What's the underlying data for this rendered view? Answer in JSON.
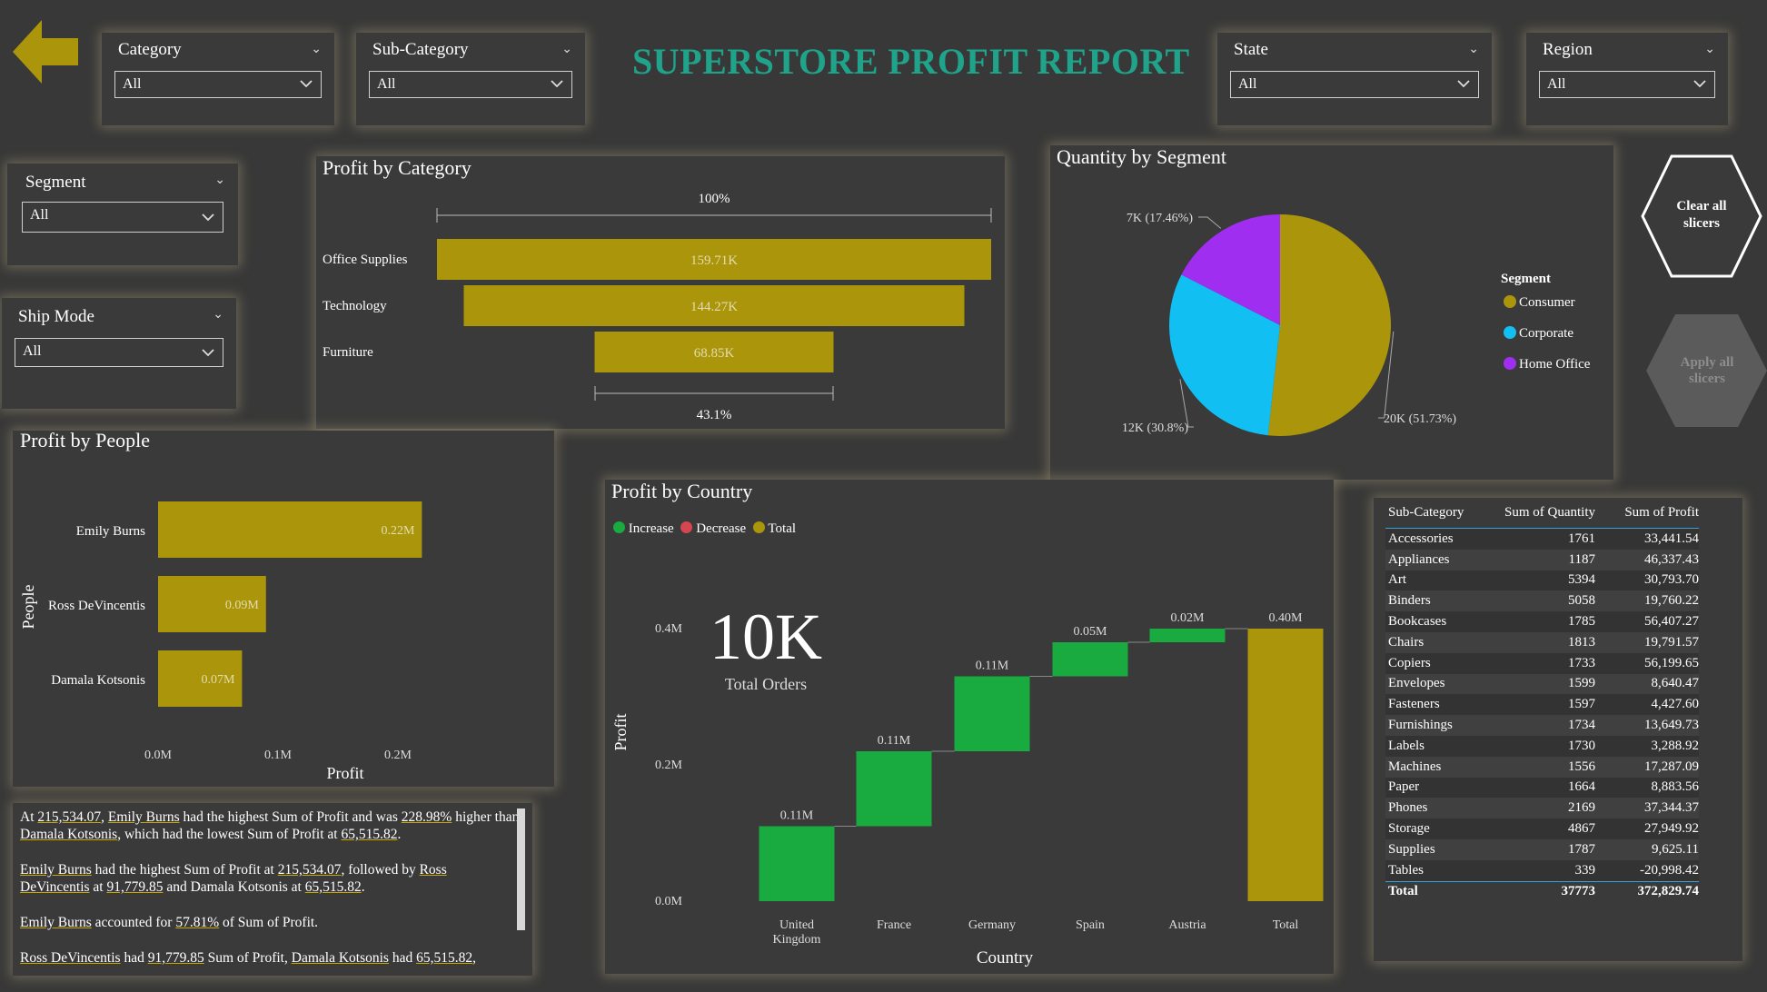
{
  "title": "SUPERSTORE PROFIT REPORT",
  "slicers": {
    "category": {
      "label": "Category",
      "value": "All"
    },
    "subcategory": {
      "label": "Sub-Category",
      "value": "All"
    },
    "state": {
      "label": "State",
      "value": "All"
    },
    "region": {
      "label": "Region",
      "value": "All"
    },
    "segment": {
      "label": "Segment",
      "value": "All"
    },
    "shipmode": {
      "label": "Ship Mode",
      "value": "All"
    }
  },
  "buttons": {
    "clear": "Clear all slicers",
    "apply": "Apply all slicers"
  },
  "colors": {
    "gold": "#ab950a",
    "green": "#1aab40",
    "blue": "#12bff2",
    "purple": "#a02ef0",
    "red": "#d64550",
    "title": "#1fa38a"
  },
  "profit_by_category": {
    "title": "Profit by Category",
    "top_pct": "100%",
    "bottom_pct": "43.1%",
    "chart_data": {
      "type": "bar",
      "categories": [
        "Office Supplies",
        "Technology",
        "Furniture"
      ],
      "values": [
        159.71,
        144.27,
        68.85
      ],
      "labels": [
        "159.71K",
        "144.27K",
        "68.85K"
      ]
    }
  },
  "quantity_by_segment": {
    "title": "Quantity by Segment",
    "legend_title": "Segment",
    "chart_data": {
      "type": "pie",
      "categories": [
        "Consumer",
        "Corporate",
        "Home Office"
      ],
      "values": [
        51.73,
        30.8,
        17.46
      ],
      "labels": [
        "20K (51.73%)",
        "12K (30.8%)",
        "7K (17.46%)"
      ]
    }
  },
  "profit_by_people": {
    "title": "Profit by People",
    "xlabel": "Profit",
    "ylabel": "People",
    "ticks": [
      "0.0M",
      "0.1M",
      "0.2M"
    ],
    "chart_data": {
      "type": "bar",
      "categories": [
        "Emily Burns",
        "Ross DeVincentis",
        "Damala Kotsonis"
      ],
      "values": [
        0.22,
        0.09,
        0.07
      ],
      "labels": [
        "0.22M",
        "0.09M",
        "0.07M"
      ],
      "xlim": [
        0,
        0.25
      ]
    }
  },
  "profit_by_country": {
    "title": "Profit by Country",
    "legend": [
      "Increase",
      "Decrease",
      "Total"
    ],
    "xlabel": "Country",
    "ylabel": "Profit",
    "yticks": [
      "0.4M",
      "0.2M",
      "0.0M"
    ],
    "kpi_value": "10K",
    "kpi_label": "Total Orders",
    "chart_data": {
      "type": "bar",
      "categories": [
        "United Kingdom",
        "France",
        "Germany",
        "Spain",
        "Austria",
        "Total"
      ],
      "values": [
        0.11,
        0.11,
        0.11,
        0.05,
        0.02,
        0.4
      ],
      "labels": [
        "0.11M",
        "0.11M",
        "0.11M",
        "0.05M",
        "0.02M",
        "0.40M"
      ],
      "ylim": [
        0,
        0.4
      ]
    }
  },
  "table": {
    "headers": [
      "Sub-Category",
      "Sum of Quantity",
      "Sum of Profit"
    ],
    "rows": [
      [
        "Accessories",
        "1761",
        "33,441.54"
      ],
      [
        "Appliances",
        "1187",
        "46,337.43"
      ],
      [
        "Art",
        "5394",
        "30,793.70"
      ],
      [
        "Binders",
        "5058",
        "19,760.22"
      ],
      [
        "Bookcases",
        "1785",
        "56,407.27"
      ],
      [
        "Chairs",
        "1813",
        "19,791.57"
      ],
      [
        "Copiers",
        "1733",
        "56,199.65"
      ],
      [
        "Envelopes",
        "1599",
        "8,640.47"
      ],
      [
        "Fasteners",
        "1597",
        "4,427.60"
      ],
      [
        "Furnishings",
        "1734",
        "13,649.73"
      ],
      [
        "Labels",
        "1730",
        "3,288.92"
      ],
      [
        "Machines",
        "1556",
        "17,287.09"
      ],
      [
        "Paper",
        "1664",
        "8,883.56"
      ],
      [
        "Phones",
        "2169",
        "37,344.37"
      ],
      [
        "Storage",
        "4867",
        "27,949.92"
      ],
      [
        "Supplies",
        "1787",
        "9,625.11"
      ],
      [
        "Tables",
        "339",
        "-20,998.42"
      ]
    ],
    "total": [
      "Total",
      "37773",
      "372,829.74"
    ]
  },
  "narrative": {
    "p1": {
      "a": "At ",
      "v1": "215,534.07",
      "b": ", ",
      "n1": "Emily Burns",
      "c": " had the highest Sum of Profit and was ",
      "v2": "228.98%",
      "d": " higher than ",
      "n2": "Damala Kotsonis",
      "e": ", which had the lowest Sum of Profit at ",
      "v3": "65,515.82",
      "f": "."
    },
    "p2": {
      "n1": "Emily Burns",
      "a": " had the highest Sum of Profit at ",
      "v1": "215,534.07",
      "b": ", followed by ",
      "n2": "Ross DeVincentis",
      "c": " at ",
      "v2": "91,779.85",
      "d": " and Damala Kotsonis at ",
      "v3": "65,515.82",
      "e": "."
    },
    "p3": {
      "n1": "Emily Burns",
      "a": " accounted for ",
      "v1": "57.81%",
      "b": " of Sum of Profit."
    },
    "p4": {
      "n1": "Ross DeVincentis",
      "a": " had ",
      "v1": "91,779.85",
      "b": " Sum of Profit, ",
      "n2": "Damala Kotsonis",
      "c": " had ",
      "v2": "65,515.82",
      "d": ","
    }
  }
}
